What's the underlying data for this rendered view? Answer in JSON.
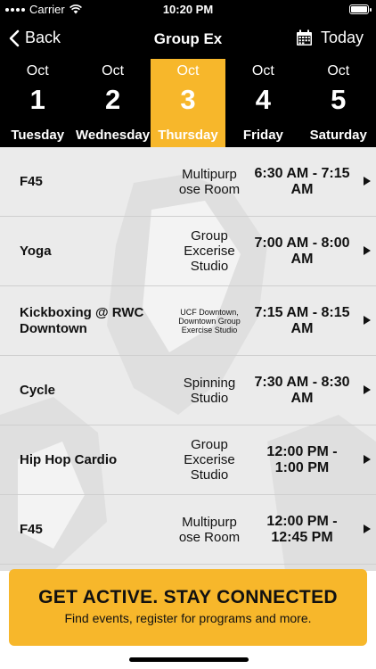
{
  "status_bar": {
    "carrier": "Carrier",
    "time": "10:20 PM"
  },
  "nav": {
    "back_label": "Back",
    "title": "Group Ex",
    "today_label": "Today"
  },
  "dates": [
    {
      "month": "Oct",
      "day": "1",
      "weekday": "Tuesday",
      "selected": false
    },
    {
      "month": "Oct",
      "day": "2",
      "weekday": "Wednesday",
      "selected": false
    },
    {
      "month": "Oct",
      "day": "3",
      "weekday": "Thursday",
      "selected": true
    },
    {
      "month": "Oct",
      "day": "4",
      "weekday": "Friday",
      "selected": false
    },
    {
      "month": "Oct",
      "day": "5",
      "weekday": "Saturday",
      "selected": false
    }
  ],
  "classes": [
    {
      "name": "F45",
      "location": "Multipurp ose Room",
      "time": "6:30 AM - 7:15 AM"
    },
    {
      "name": "Yoga",
      "location": "Group Excerise Studio",
      "time": "7:00 AM - 8:00 AM"
    },
    {
      "name": "Kickboxing @ RWC Downtown",
      "location": "UCF Downtown, Downtown Group Exercise Studio",
      "time": "7:15 AM - 8:15 AM"
    },
    {
      "name": "Cycle",
      "location": "Spinning Studio",
      "time": "7:30 AM - 8:30 AM"
    },
    {
      "name": "Hip Hop Cardio",
      "location": "Group Excerise Studio",
      "time": "12:00 PM - 1:00 PM"
    },
    {
      "name": "F45",
      "location": "Multipurp ose Room",
      "time": "12:00 PM - 12:45 PM"
    }
  ],
  "banner": {
    "headline": "GET ACTIVE.  STAY CONNECTED",
    "subtext": "Find events, register for programs and more."
  },
  "colors": {
    "accent": "#f7b72b",
    "bar": "#000000"
  },
  "icons": {
    "back": "chevron-left-icon",
    "calendar": "calendar-icon",
    "row_arrow": "triangle-right-icon"
  }
}
